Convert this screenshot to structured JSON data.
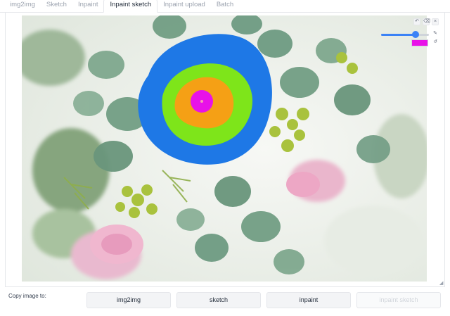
{
  "tabs": [
    {
      "label": "img2img",
      "selected": false
    },
    {
      "label": "Sketch",
      "selected": false
    },
    {
      "label": "Inpaint",
      "selected": false
    },
    {
      "label": "Inpaint sketch",
      "selected": true
    },
    {
      "label": "Inpaint upload",
      "selected": false
    },
    {
      "label": "Batch",
      "selected": false
    }
  ],
  "canvas": {
    "image": "flower-bouquet-photo",
    "brush_color": "#e812e8",
    "brush_size_fraction": 0.72,
    "sketch_colors": [
      "#1e78e6",
      "#7ee51a",
      "#f5a015",
      "#e812e8"
    ],
    "toolbar_icons": [
      "undo-icon",
      "clear-icon",
      "close-icon"
    ],
    "side_icons": [
      "brush-icon",
      "color-reset-icon"
    ]
  },
  "copy": {
    "label": "Copy image to:",
    "buttons": [
      {
        "label": "img2img",
        "disabled": false
      },
      {
        "label": "sketch",
        "disabled": false
      },
      {
        "label": "inpaint",
        "disabled": false
      },
      {
        "label": "inpaint sketch",
        "disabled": true
      }
    ]
  }
}
